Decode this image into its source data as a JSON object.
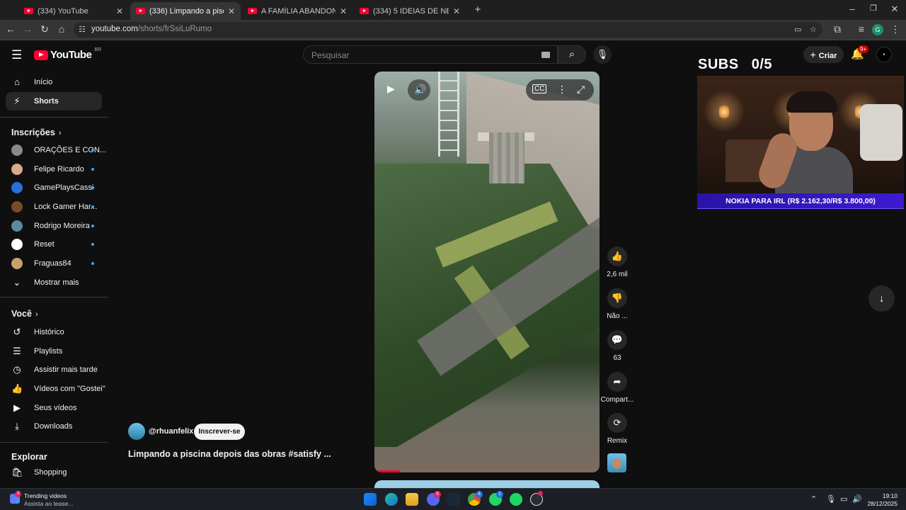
{
  "browser": {
    "tabs": [
      {
        "title": "(334) YouTube",
        "active": false
      },
      {
        "title": "(336) Limpando a piscina depois das obras",
        "active": true
      },
      {
        "title": "A FAMÍLIA ABANDONOU esse lugar",
        "active": false
      },
      {
        "title": "(334) 5 IDEIAS DE NEGÓCIOS PARA",
        "active": false
      }
    ],
    "url_host": "youtube.com",
    "url_path": "/shorts/frSsiLuRumo",
    "profile_initial": "G"
  },
  "masthead": {
    "logo_text": "YouTube",
    "country_code": "BR",
    "search_placeholder": "Pesquisar",
    "create_label": "Criar",
    "notification_count": "9+"
  },
  "sidebar": {
    "main": [
      {
        "label": "Início",
        "icon": "home-icon"
      },
      {
        "label": "Shorts",
        "icon": "shorts-icon",
        "active": true
      }
    ],
    "subscriptions_title": "Inscrições",
    "subscriptions": [
      {
        "label": "ORAÇÕES E CON...",
        "color": "#8a8a8a"
      },
      {
        "label": "Felipe Ricardo",
        "color": "#d8a98a"
      },
      {
        "label": "GamePlaysCassi",
        "color": "#2a6fdb"
      },
      {
        "label": "Lock Gamer Har...",
        "color": "#7a4a2a"
      },
      {
        "label": "Rodrigo Moreira",
        "color": "#5a8aa0"
      },
      {
        "label": "Reset",
        "color": "#ffffff"
      },
      {
        "label": "Fraguas84",
        "color": "#c9a26a"
      }
    ],
    "show_more": "Mostrar mais",
    "you_title": "Você",
    "you_items": [
      {
        "label": "Histórico",
        "icon": "history-icon"
      },
      {
        "label": "Playlists",
        "icon": "playlists-icon"
      },
      {
        "label": "Assistir mais tarde",
        "icon": "watch-later-icon"
      },
      {
        "label": "Vídeos com \"Gostei\"",
        "icon": "liked-icon"
      },
      {
        "label": "Seus vídeos",
        "icon": "your-videos-icon"
      },
      {
        "label": "Downloads",
        "icon": "download-icon"
      }
    ],
    "explore_title": "Explorar",
    "explore_items": [
      {
        "label": "Shopping",
        "icon": "shopping-icon"
      }
    ]
  },
  "short": {
    "channel": "@rhuanfelix",
    "subscribe_label": "Inscrever-se",
    "title": "Limpando a piscina depois das obras #satisfy ...",
    "likes": "2,6 mil",
    "dislike_label": "Não ...",
    "comments": "63",
    "share_label": "Compart...",
    "remix_label": "Remix"
  },
  "overlay": {
    "subs_label": "SUBS",
    "subs_count": "0/5",
    "banner": "NOKIA PARA IRL (R$ 2.162,30/R$ 3.800,00)"
  },
  "taskbar": {
    "widget_title": "Trending videos",
    "widget_subtitle": "Assista ao tease...",
    "widget_badge": "3",
    "time": "19:10",
    "date": "28/12/2025"
  }
}
